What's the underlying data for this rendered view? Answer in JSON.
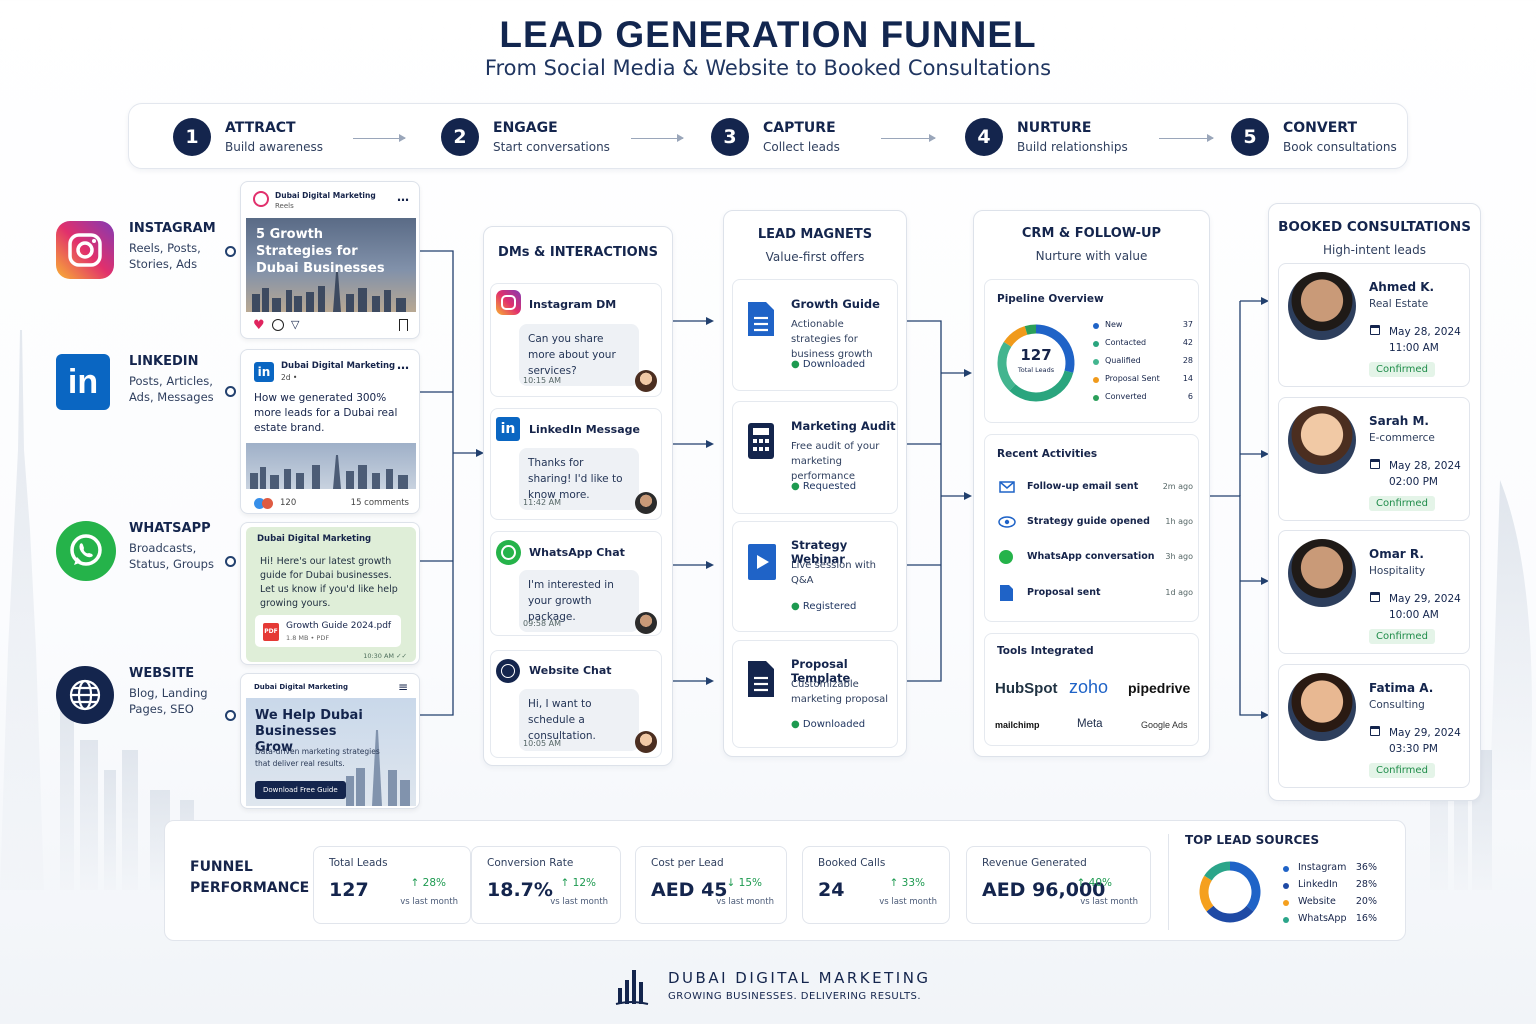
{
  "header": {
    "title": "LEAD GENERATION FUNNEL",
    "subtitle": "From Social Media & Website to Booked Consultations"
  },
  "steps": [
    {
      "num": "1",
      "title": "ATTRACT",
      "sub": "Build awareness"
    },
    {
      "num": "2",
      "title": "ENGAGE",
      "sub": "Start conversations"
    },
    {
      "num": "3",
      "title": "CAPTURE",
      "sub": "Collect leads"
    },
    {
      "num": "4",
      "title": "NURTURE",
      "sub": "Build relationships"
    },
    {
      "num": "5",
      "title": "CONVERT",
      "sub": "Book consultations"
    }
  ],
  "channels": [
    {
      "name": "INSTAGRAM",
      "sub1": "Reels, Posts,",
      "sub2": "Stories, Ads",
      "icon": "instagram-icon"
    },
    {
      "name": "LINKEDIN",
      "sub1": "Posts, Articles,",
      "sub2": "Ads, Messages",
      "icon": "linkedin-icon"
    },
    {
      "name": "WHATSAPP",
      "sub1": "Broadcasts,",
      "sub2": "Status, Groups",
      "icon": "whatsapp-icon"
    },
    {
      "name": "WEBSITE",
      "sub1": "Blog, Landing",
      "sub2": "Pages, SEO",
      "icon": "globe-icon"
    }
  ],
  "posts": {
    "instagram": {
      "account": "Dubai Digital Marketing",
      "type": "Reels",
      "headline": "5 Growth Strategies for Dubai Businesses"
    },
    "linkedin": {
      "account": "Dubai Digital Marketing",
      "age": "2d •",
      "text": "How we generated 300% more leads for a Dubai real estate brand.",
      "reactions": "120",
      "comments": "15 comments"
    },
    "whatsapp": {
      "account": "Dubai Digital Marketing",
      "text": "Hi! Here's our latest growth guide for Dubai businesses. Let us know if you'd like help growing yours.",
      "file": "Growth Guide 2024.pdf",
      "filemeta": "1.8 MB • PDF",
      "filetype": "PDF",
      "time": "10:30 AM ✓✓"
    },
    "website": {
      "account": "Dubai Digital Marketing",
      "headline": "We Help Dubai Businesses Grow",
      "text": "Data-driven marketing strategies that deliver real results.",
      "button": "Download Free Guide"
    }
  },
  "dms": {
    "title": "DMs & INTERACTIONS",
    "items": [
      {
        "channel": "Instagram DM",
        "text": "Can you share more about your services?",
        "time": "10:15 AM"
      },
      {
        "channel": "LinkedIn Message",
        "text": "Thanks for sharing! I'd like to know more.",
        "time": "11:42 AM"
      },
      {
        "channel": "WhatsApp Chat",
        "text": "I'm interested in your growth package.",
        "time": "09:58 AM"
      },
      {
        "channel": "Website Chat",
        "text": "Hi, I want to schedule a consultation.",
        "time": "10:05 AM"
      }
    ]
  },
  "magnets": {
    "title": "LEAD MAGNETS",
    "sub": "Value-first offers",
    "items": [
      {
        "title": "Growth Guide",
        "desc": "Actionable strategies for business growth",
        "status": "Downloaded",
        "icon": "document-icon"
      },
      {
        "title": "Marketing Audit",
        "desc": "Free audit of your marketing performance",
        "status": "Requested",
        "icon": "calculator-icon"
      },
      {
        "title": "Strategy Webinar",
        "desc": "Live session with Q&A",
        "status": "Registered",
        "icon": "play-icon"
      },
      {
        "title": "Proposal Template",
        "desc": "Customizable marketing proposal",
        "status": "Downloaded",
        "icon": "document-icon"
      }
    ]
  },
  "crm": {
    "title": "CRM & FOLLOW-UP",
    "sub": "Nurture with value",
    "pipeline": {
      "title": "Pipeline Overview",
      "total": "127",
      "total_label": "Total Leads",
      "stages": [
        {
          "name": "New",
          "count": 37,
          "color": "#1f63c7"
        },
        {
          "name": "Contacted",
          "count": 42,
          "color": "#2aa57e"
        },
        {
          "name": "Qualified",
          "count": 28,
          "color": "#43b58f"
        },
        {
          "name": "Proposal Sent",
          "count": 14,
          "color": "#f09a1b"
        },
        {
          "name": "Converted",
          "count": 6,
          "color": "#2b9f5a"
        }
      ]
    },
    "activities_title": "Recent Activities",
    "activities": [
      {
        "text": "Follow-up email sent",
        "time": "2m ago",
        "icon": "mail-icon"
      },
      {
        "text": "Strategy guide opened",
        "time": "1h ago",
        "icon": "eye-icon"
      },
      {
        "text": "WhatsApp conversation",
        "time": "3h ago",
        "icon": "whatsapp-icon"
      },
      {
        "text": "Proposal sent",
        "time": "1d ago",
        "icon": "document-icon"
      }
    ],
    "tools_title": "Tools Integrated",
    "tools": [
      "HubSpot",
      "zoho",
      "pipedrive",
      "mailchimp",
      "Meta",
      "Google Ads"
    ]
  },
  "bookings": {
    "title": "BOOKED CONSULTATIONS",
    "sub": "High-intent leads",
    "items": [
      {
        "name": "Ahmed K.",
        "industry": "Real Estate",
        "date": "May 28, 2024",
        "time": "11:00 AM",
        "status": "Confirmed"
      },
      {
        "name": "Sarah M.",
        "industry": "E-commerce",
        "date": "May 28, 2024",
        "time": "02:00 PM",
        "status": "Confirmed"
      },
      {
        "name": "Omar R.",
        "industry": "Hospitality",
        "date": "May 29, 2024",
        "time": "10:00 AM",
        "status": "Confirmed"
      },
      {
        "name": "Fatima A.",
        "industry": "Consulting",
        "date": "May 29, 2024",
        "time": "03:30 PM",
        "status": "Confirmed"
      }
    ]
  },
  "performance": {
    "title1": "FUNNEL",
    "title2": "PERFORMANCE",
    "kpis": [
      {
        "label": "Total Leads",
        "value": "127",
        "change": "28%",
        "dir": "up",
        "note": "vs last month"
      },
      {
        "label": "Conversion Rate",
        "value": "18.7%",
        "change": "12%",
        "dir": "up",
        "note": "vs last month"
      },
      {
        "label": "Cost per Lead",
        "value": "AED 45",
        "change": "15%",
        "dir": "down",
        "note": "vs last month"
      },
      {
        "label": "Booked Calls",
        "value": "24",
        "change": "33%",
        "dir": "up",
        "note": "vs last month"
      },
      {
        "label": "Revenue Generated",
        "value": "AED 96,000",
        "change": "40%",
        "dir": "up",
        "note": "vs last month"
      }
    ]
  },
  "sources": {
    "title": "TOP LEAD SOURCES",
    "items": [
      {
        "name": "Instagram",
        "pct": 36,
        "label": "36%",
        "color": "#1f63c7"
      },
      {
        "name": "LinkedIn",
        "pct": 28,
        "label": "28%",
        "color": "#1f4aa5"
      },
      {
        "name": "Website",
        "pct": 20,
        "label": "20%",
        "color": "#f5a01e"
      },
      {
        "name": "WhatsApp",
        "pct": 16,
        "label": "16%",
        "color": "#2ba58a"
      }
    ]
  },
  "brand": {
    "name": "DUBAI DIGITAL MARKETING",
    "tagline": "GROWING BUSINESSES. DELIVERING RESULTS."
  }
}
